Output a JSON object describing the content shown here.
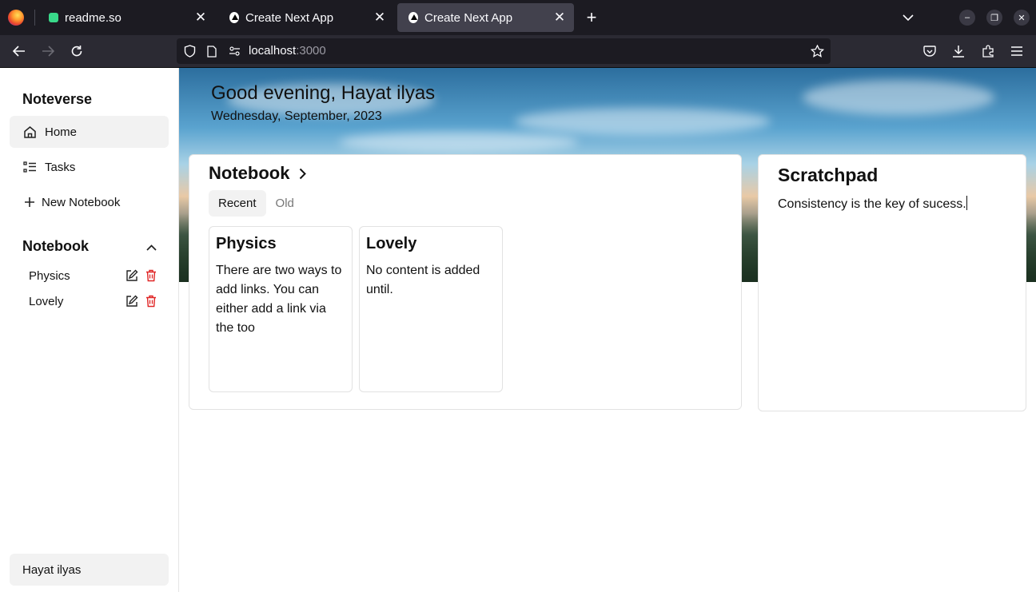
{
  "browser": {
    "tabs": [
      {
        "title": "readme.so",
        "active": false
      },
      {
        "title": "Create Next App",
        "active": false
      },
      {
        "title": "Create Next App",
        "active": true
      }
    ],
    "url_host": "localhost",
    "url_port": ":3000"
  },
  "sidebar": {
    "brand": "Noteverse",
    "nav": [
      {
        "label": "Home",
        "icon": "home-icon",
        "active": true
      },
      {
        "label": "Tasks",
        "icon": "list-icon",
        "active": false
      },
      {
        "label": "New Notebook",
        "icon": "plus-icon",
        "active": false
      }
    ],
    "section_title": "Notebook",
    "notebooks": [
      {
        "label": "Physics"
      },
      {
        "label": "Lovely"
      }
    ],
    "user": "Hayat ilyas"
  },
  "header": {
    "greeting": "Good evening, Hayat ilyas",
    "date": "Wednesday, September, 2023"
  },
  "notebook_panel": {
    "title": "Notebook",
    "tabs": [
      {
        "label": "Recent",
        "active": true
      },
      {
        "label": "Old",
        "active": false
      }
    ],
    "notes": [
      {
        "title": "Physics",
        "content": "There are two ways to add links. You can either add a link via the too"
      },
      {
        "title": "Lovely",
        "content": "No content is added until."
      }
    ]
  },
  "scratchpad": {
    "title": "Scratchpad",
    "text": "Consistency is the key of sucess."
  },
  "colors": {
    "tabbar": "#1c1b22",
    "navbar": "#2b2a33",
    "delete": "#e02424"
  }
}
